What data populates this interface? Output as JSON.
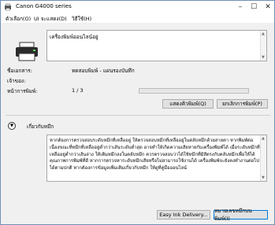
{
  "window": {
    "title": "Canon G4000 series"
  },
  "menu": {
    "items": [
      "ตัวเลือก(O)",
      "UI จะแสดง(D)",
      "วิธีใช้(H)"
    ]
  },
  "status": {
    "message": "เครื่องพิมพ์ออนไลน์อยู่"
  },
  "fields": {
    "document_label": "ชื่อเอกสาร:",
    "document_value": "ทดสอบพิมพ์ - แผ่นรองบันทึก",
    "owner_label": "เจ้าของ:",
    "owner_value": "",
    "pages_label": "หน้าการพิมพ์:",
    "pages_value": "1 / 3",
    "progress_fraction": 0.0
  },
  "buttons": {
    "display_queue": "แสดงคิวพิมพ์(Q)",
    "cancel_printing": "ยกเลิกการพิมพ์(P)",
    "easy_ink_delivery": "Easy Ink Delivery...",
    "ink_details": "หมายเลขหมึกบนพิมพ์(I)"
  },
  "guide": {
    "toggle_symbol": "▼",
    "label": "เกี่ยวกับหมึก",
    "text": "หากต้องการตรวจสอบระดับหมึกที่เหลืออยู่ ให้ตรวจสอบหมึกที่เหลืออยู่ในตลับหมึกด้วยสายตา หากพิมพ์ต่อเนื่องขณะที่หมึกที่เหลืออยู่ต่ำกว่าเส้นระดับต่ำสุด อาจทำให้เกิดความเสียหายกับเครื่องพิมพ์ได้ เมื่อระดับหมึกที่เหลืออยู่ต่ำกว่าเส้นล่าง ให้เติมหมึกลงในตลับหมึก ควรตรวจสอบว่าได้ใช้หมึกที่มีสีตรงกับตลับหมึกเพื่อให้ได้คุณภาพการพิมพ์ที่ดี หากการตรวจหาระดับหมึกเสียหรือไม่สามารถใช้งานได้ เครื่องพิมพ์จะยังคงทำงานต่อไปได้ตามปกติ หากต้องการข้อมูลเพิ่มเติมเกี่ยวกับหมึก ให้ดูที่คู่มือออนไลน์"
  },
  "colors": {
    "progress_fill": "#2da9e1",
    "focus": "#0078d7"
  }
}
